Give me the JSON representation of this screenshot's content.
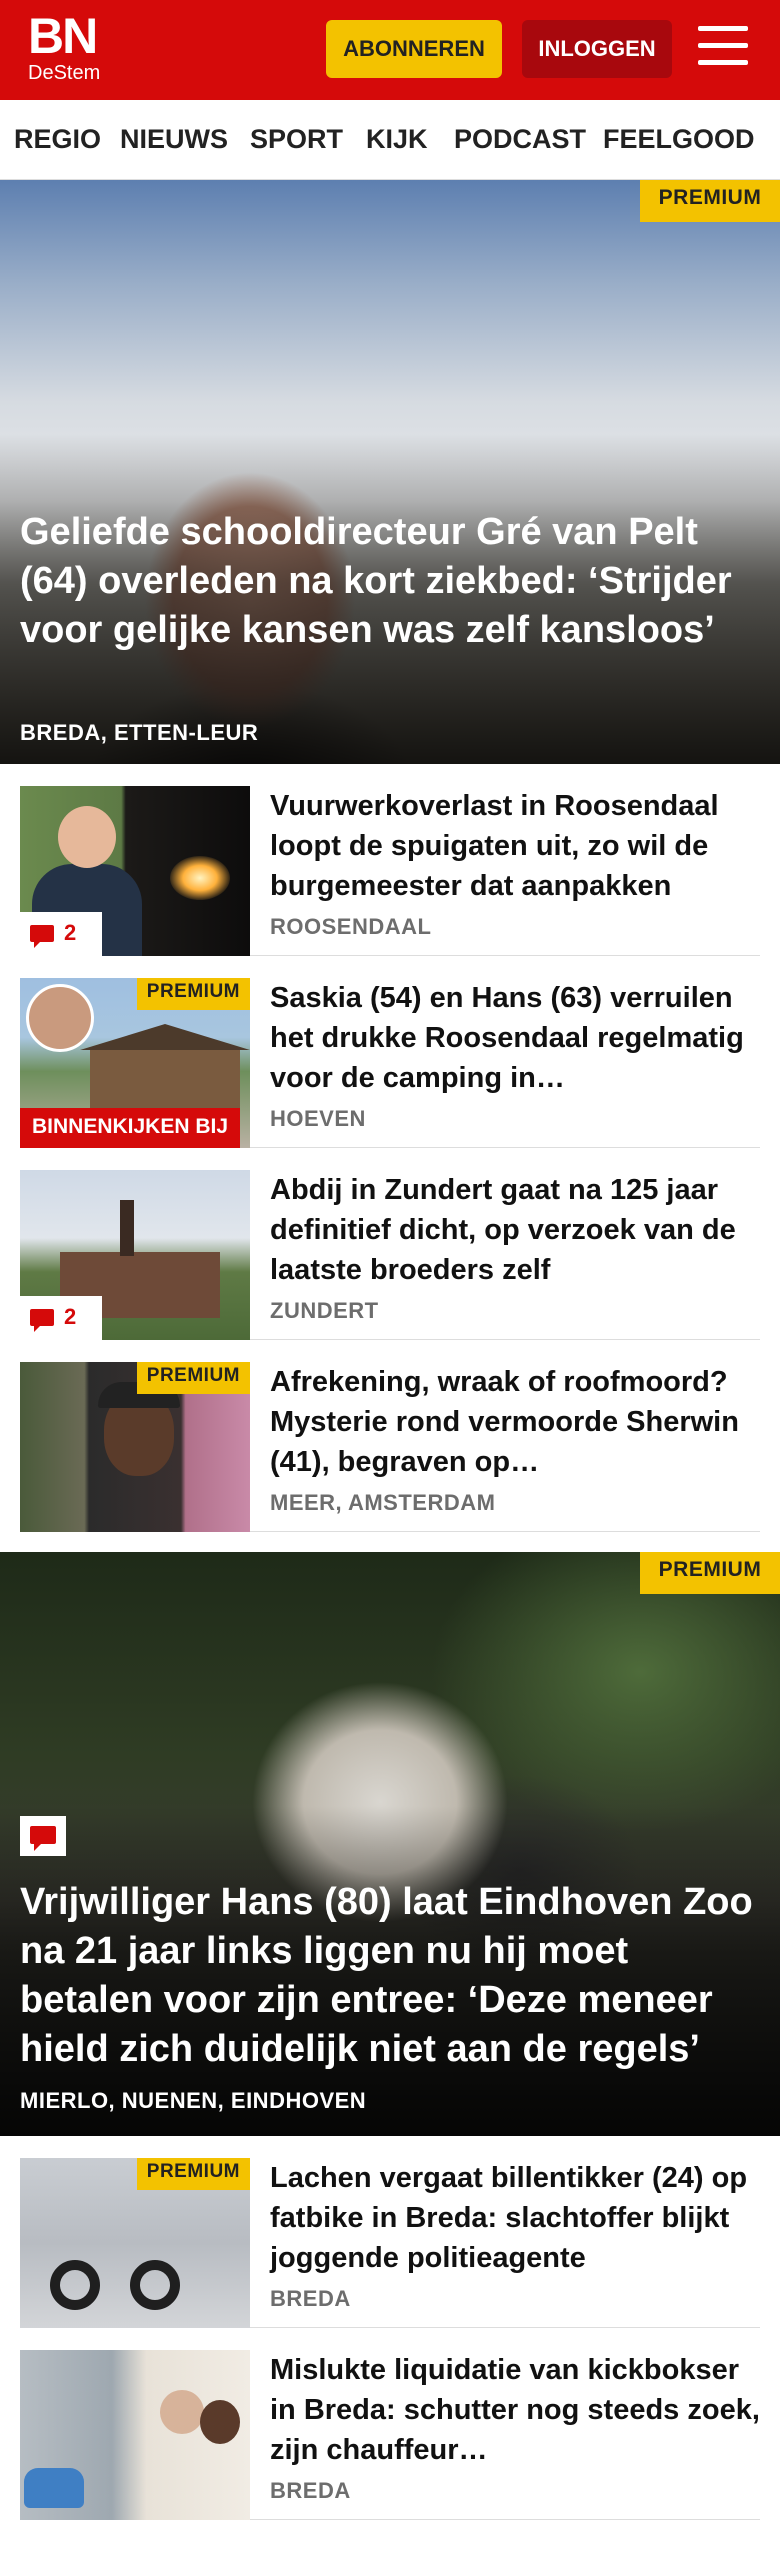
{
  "header": {
    "logo_text": "BN",
    "logo_subtext": "DeStem",
    "subscribe_label": "ABONNEREN",
    "login_label": "INLOGGEN",
    "brand_color": "#d50a0a"
  },
  "nav": {
    "items": [
      "REGIO",
      "NIEUWS",
      "SPORT",
      "KIJK",
      "PODCAST",
      "FEELGOOD"
    ]
  },
  "hero1": {
    "badge": "PREMIUM",
    "title": "Geliefde schooldirecteur Gré van Pelt (64) overleden na kort ziekbed: ‘Strijder voor gelijke kansen was zelf kansloos’",
    "location": "BREDA, ETTEN-LEUR"
  },
  "articles1": [
    {
      "title": "Vuurwerkoverlast in Roosendaal loopt de spuigaten uit, zo wil de burgemeester dat aanpakken",
      "location": "ROOSENDAAL",
      "comments": "2"
    },
    {
      "title": "Saskia (54) en Hans (63) verruilen het drukke Roosendaal regelmatig voor de camping in…",
      "location": "HOEVEN",
      "badge": "PREMIUM",
      "category": "BINNENKIJKEN BIJ"
    },
    {
      "title": "Abdij in Zundert gaat na 125 jaar definitief dicht, op verzoek van de laatste broeders zelf",
      "location": "ZUNDERT",
      "comments": "2"
    },
    {
      "title": "Afrekening, wraak of roofmoord? Mysterie rond vermoorde Sherwin (41), begraven op…",
      "location": "MEER, AMSTERDAM",
      "badge": "PREMIUM"
    }
  ],
  "hero2": {
    "badge": "PREMIUM",
    "title": "Vrijwilliger Hans (80) laat Eindhoven Zoo na 21 jaar links liggen nu hij moet betalen voor zijn entree: ‘Deze meneer hield zich duidelijk niet aan de regels’",
    "location": "MIERLO, NUENEN, EINDHOVEN"
  },
  "articles2": [
    {
      "title": "Lachen vergaat billentikker (24) op fatbike in Breda: slachtoffer blijkt joggende politieagente",
      "location": "BREDA",
      "badge": "PREMIUM"
    },
    {
      "title": "Mislukte liquidatie van kickbokser in Breda: schutter nog steeds zoek, zijn chauffeur…",
      "location": "BREDA"
    }
  ]
}
